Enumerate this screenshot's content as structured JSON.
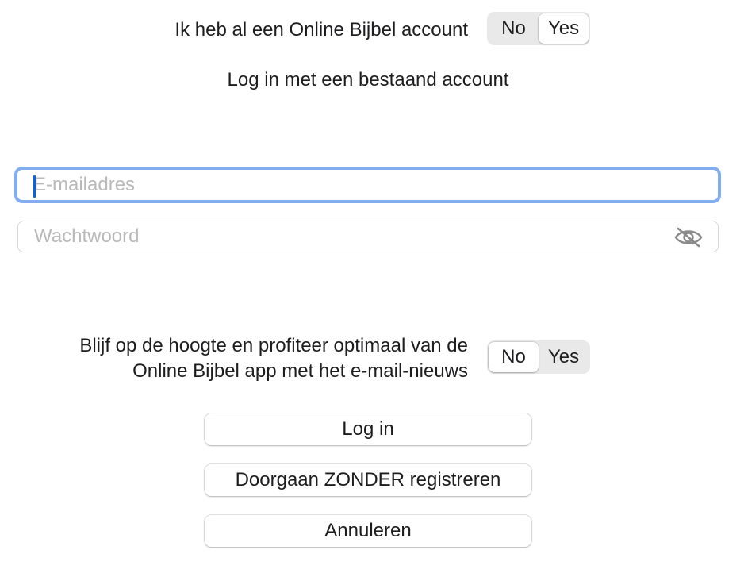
{
  "account": {
    "question": "Ik heb al een Online Bijbel account",
    "options": [
      "No",
      "Yes"
    ],
    "selected": "Yes"
  },
  "subtitle": "Log in met een bestaand account",
  "email": {
    "placeholder": "E-mailadres",
    "value": ""
  },
  "password": {
    "placeholder": "Wachtwoord",
    "value": "",
    "visibility_icon": "eye-slash-icon"
  },
  "newsletter": {
    "line1": "Blijf op de hoogte en profiteer optimaal van de",
    "line2": "Online Bijbel app met het e-mail-nieuws",
    "options": [
      "No",
      "Yes"
    ],
    "selected": "No"
  },
  "buttons": {
    "login": "Log in",
    "continue_without": "Doorgaan ZONDER registreren",
    "cancel": "Annuleren"
  },
  "colors": {
    "focus_ring": "#82aef1",
    "caret": "#0a64e1",
    "segment_bg": "#e9e9e9"
  }
}
